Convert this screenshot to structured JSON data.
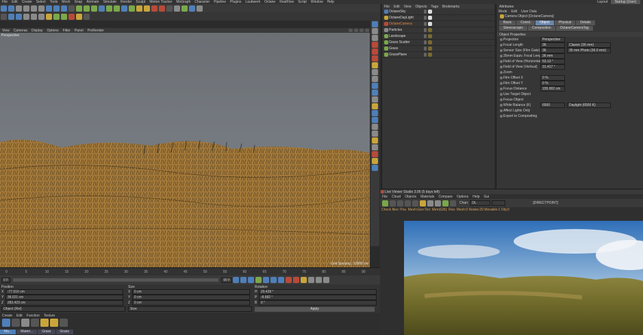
{
  "app": {
    "menu": [
      "File",
      "Edit",
      "Create",
      "Select",
      "Tools",
      "Mesh",
      "Snap",
      "Animate",
      "Simulate",
      "Render",
      "Sculpt",
      "Motion Tracker",
      "MoGraph",
      "Character",
      "Pipeline",
      "Plugins",
      "Laubwerk",
      "Octane",
      "RealFlow",
      "Script",
      "Window",
      "Help"
    ],
    "layout_label": "Layout:",
    "layout_value": "Startup (User)"
  },
  "viewport": {
    "menu": [
      "View",
      "Cameras",
      "Display",
      "Options",
      "Filter",
      "Panel",
      "ProRender"
    ],
    "name": "Perspective",
    "grid_spacing": "Grid Spacing : 10000 cm",
    "status": "0:00:00:00"
  },
  "timeline": {
    "ticks": [
      "0",
      "5",
      "10",
      "15",
      "20",
      "25",
      "30",
      "35",
      "40",
      "45",
      "50",
      "55",
      "60",
      "65",
      "70",
      "75",
      "80",
      "85",
      "90"
    ],
    "start": "0 F",
    "end": "90 F",
    "current": "0 F"
  },
  "coords": {
    "headers": [
      "Position",
      "Size",
      "Rotation"
    ],
    "rows": [
      {
        "pos": "-77.516 cm",
        "size": "0 cm",
        "rot": "20.428 °",
        "pl": "X",
        "sl": "X",
        "rl": "H"
      },
      {
        "pos": "38.021 cm",
        "size": "0 cm",
        "rot": "-8.682 °",
        "pl": "Y",
        "sl": "Y",
        "rl": "P"
      },
      {
        "pos": "283.423 cm",
        "size": "0 cm",
        "rot": "0 °",
        "pl": "Z",
        "sl": "Z",
        "rl": "B"
      }
    ],
    "mode": "Object (Rel)",
    "size_mode": "Size",
    "apply": "Apply"
  },
  "materials": {
    "menu": [
      "Create",
      "Edit",
      "Function",
      "Texture"
    ],
    "bottom_tabs": [
      "Ma...",
      "Materi...",
      "Grass",
      "Grass"
    ]
  },
  "objects": {
    "menu": [
      "File",
      "Edit",
      "View",
      "Objects",
      "Tags",
      "Bookmarks"
    ],
    "items": [
      "OctaneSky",
      "OctaneDayLight",
      "OctaneCamera",
      "Particles",
      "Landscape",
      "Grass Scatter",
      "Grass",
      "GrassPlane"
    ]
  },
  "attributes": {
    "title": "Attributes",
    "menu": [
      "Mode",
      "Edit",
      "User Data"
    ],
    "object_line": "Camera Object [OctaneCamera]",
    "tabs_row1": [
      "Basic",
      "Coord.",
      "Object",
      "Physical",
      "Details"
    ],
    "tabs_row2": [
      "Stereoscopic",
      "Composition",
      "OctaneCameraTag"
    ],
    "active_tab": "Object",
    "section": "Object Properties",
    "props": [
      {
        "label": "Projection",
        "value": "Perspective"
      },
      {
        "label": "Focal Length",
        "value": "36",
        "extra": "Classic (36 mm)"
      },
      {
        "label": "Sensor Size (Film Gate)",
        "value": "36",
        "extra": "35 mm Photo (36.0 mm)"
      },
      {
        "label": "35mm Equiv. Focal Length:",
        "value": "36 mm"
      },
      {
        "label": "Field of View (Horizontal)",
        "value": "53.13 °"
      },
      {
        "label": "Field of View (Vertical)",
        "value": "31.417 °"
      },
      {
        "label": "Zoom",
        "value": ""
      },
      {
        "label": "Film Offset X",
        "value": "0 %"
      },
      {
        "label": "Film Offset Y",
        "value": "0 %"
      },
      {
        "label": "Focus Distance",
        "value": "155.002 cm"
      },
      {
        "label": "Use Target Object",
        "value": ""
      },
      {
        "label": "Focus Object",
        "value": ""
      },
      {
        "label": "White Balance (K)",
        "value": "6500",
        "extra": "Daylight (6500 K)"
      },
      {
        "label": "Affect Lights Only",
        "value": ""
      },
      {
        "label": "Export to Compositing",
        "value": ""
      }
    ]
  },
  "render": {
    "title": "Live Viewer Studio 3.06 (5 days left)",
    "menu": [
      "File",
      "Cloud",
      "Objects",
      "Materials",
      "Compare",
      "Options",
      "Help",
      "Gui"
    ],
    "channel_label": "Chan:",
    "channel_value": "DL",
    "renderer": "[DIRECTPOINT]",
    "status": "Check files: Pos. Mesh:Geo:Tex: Mem(GB): Res: Mesh:0 Nodes:29 Movable:1 Obj:0"
  },
  "colors": {
    "ground": "#a57a3a",
    "viewport_bg": "#6e7277",
    "accent": "#6a86ad",
    "bg": "#2b2b2b"
  }
}
